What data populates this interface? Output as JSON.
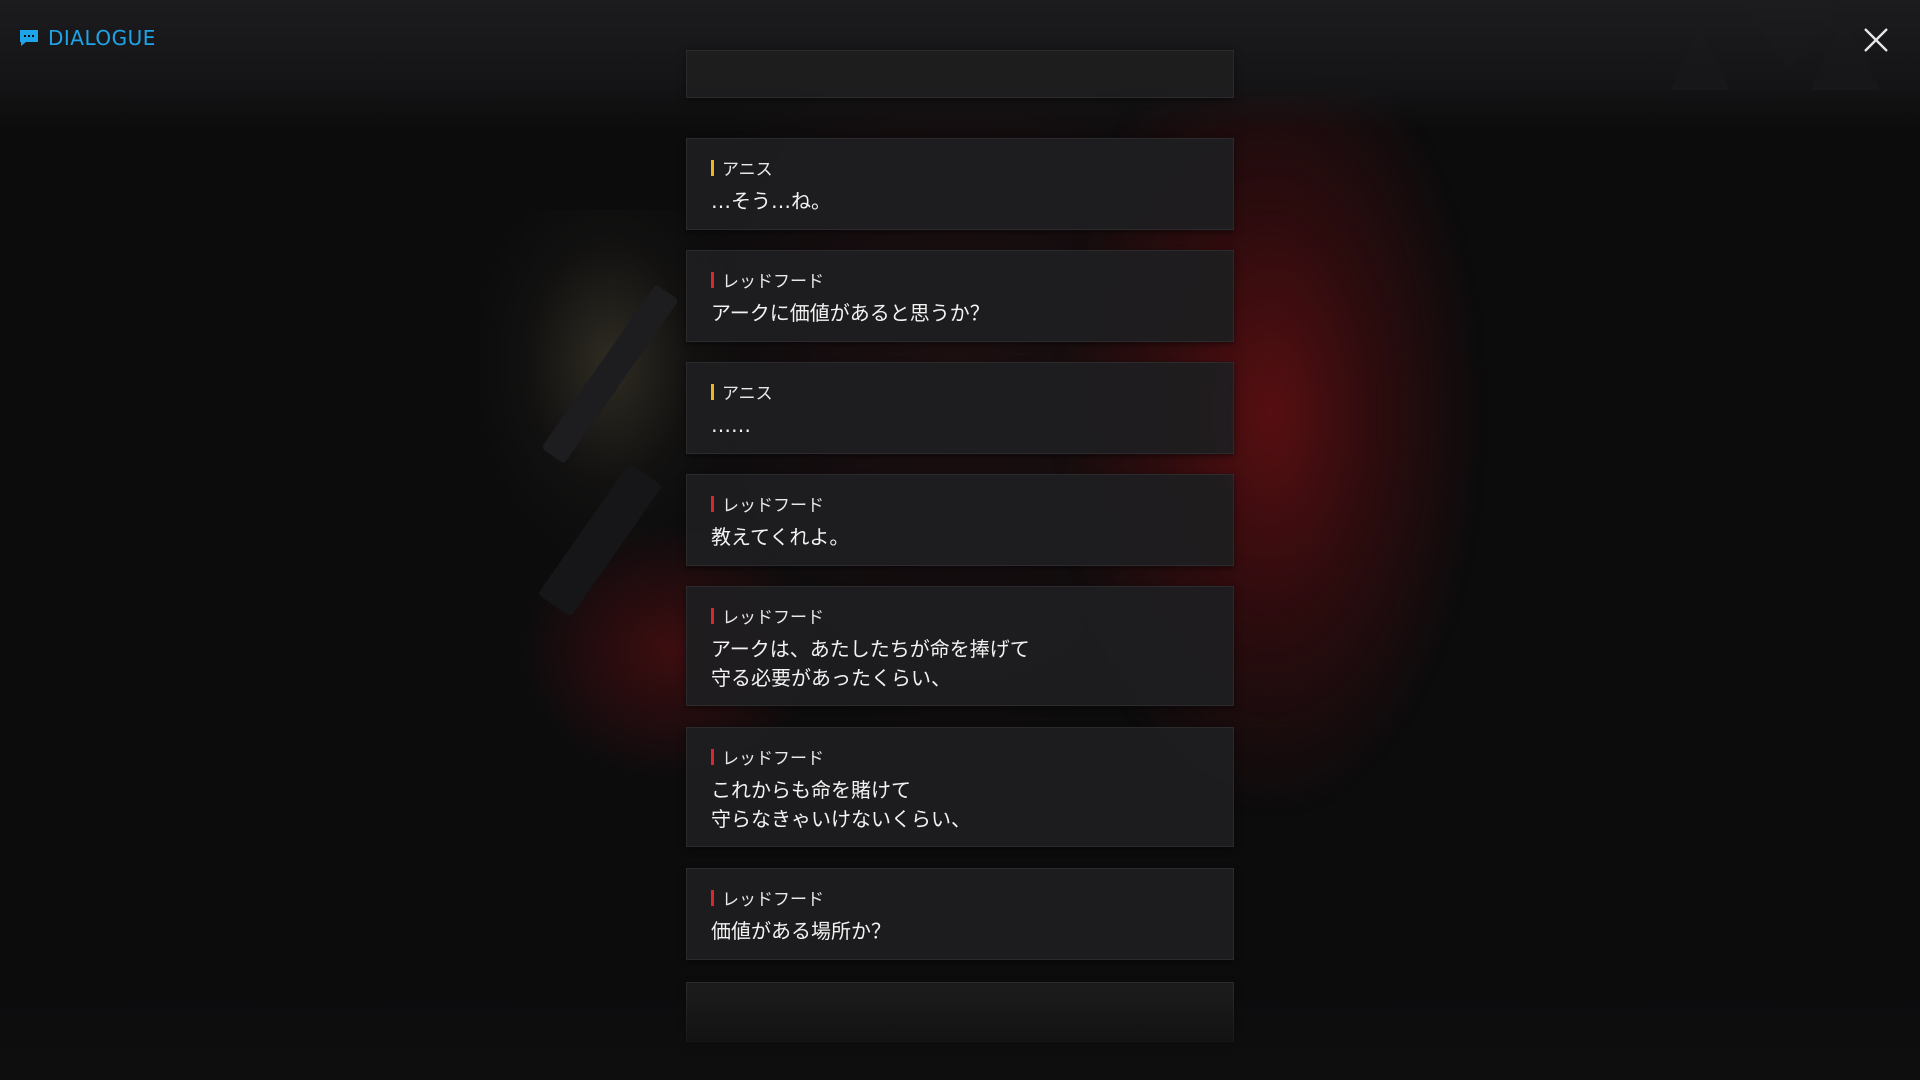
{
  "header": {
    "title": "DIALOGUE",
    "icon": "chat-bubble-icon",
    "accent_color": "#1fa4ea"
  },
  "close": {
    "icon": "close-icon",
    "color": "#e6e6e6"
  },
  "speaker_colors": {
    "アニス": "#f0b323",
    "レッドフード": "#d8272d"
  },
  "dialogue": [
    {
      "speaker": "アニス",
      "text": "…そう…ね。"
    },
    {
      "speaker": "レッドフード",
      "text": "アークに価値があると思うか？"
    },
    {
      "speaker": "アニス",
      "text": "……"
    },
    {
      "speaker": "レッドフード",
      "text": "教えてくれよ。"
    },
    {
      "speaker": "レッドフード",
      "text": "アークは、あたしたちが命を捧げて\n守る必要があったくらい、"
    },
    {
      "speaker": "レッドフード",
      "text": "これからも命を賭けて\n守らなきゃいけないくらい、"
    },
    {
      "speaker": "レッドフード",
      "text": "価値がある場所か？"
    }
  ]
}
